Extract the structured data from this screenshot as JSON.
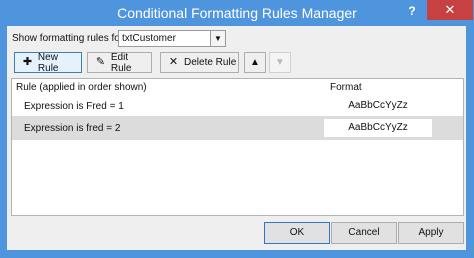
{
  "window": {
    "title": "Conditional Formatting Rules Manager",
    "help": "?",
    "close": "✕"
  },
  "show_for": {
    "label": "Show formatting rules for:",
    "value": "txtCustomer"
  },
  "toolbar": {
    "new_rule": "New Rule",
    "edit_rule": "Edit Rule",
    "delete_rule": "Delete Rule"
  },
  "table": {
    "col_rule": "Rule (applied in order shown)",
    "col_format": "Format",
    "rows": [
      {
        "rule": "Expression is  Fred = 1",
        "format": "AaBbCcYyZz"
      },
      {
        "rule": "Expression is fred = 2",
        "format": "AaBbCcYyZz"
      }
    ]
  },
  "footer": {
    "ok": "OK",
    "cancel": "Cancel",
    "apply": "Apply"
  }
}
